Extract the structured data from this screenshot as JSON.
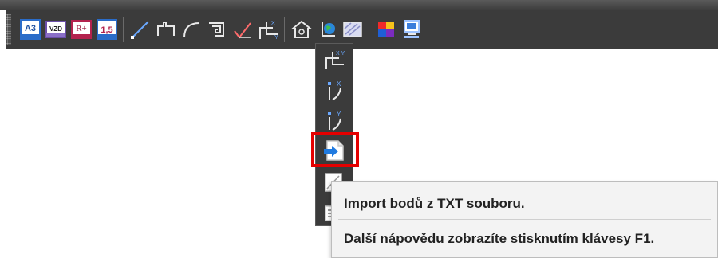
{
  "toolbar": {
    "icons": [
      {
        "name": "a3-paper-icon",
        "label": "A3"
      },
      {
        "name": "vzd-icon",
        "label": "VZD"
      },
      {
        "name": "r-plus-icon",
        "label": "R+"
      },
      {
        "name": "text-height-icon",
        "label": "1,5"
      },
      {
        "name": "line-icon"
      },
      {
        "name": "polyline-icon"
      },
      {
        "name": "arc-icon"
      },
      {
        "name": "offset-icon"
      },
      {
        "name": "check-angle-icon"
      },
      {
        "name": "coordinate-xy-icon",
        "label": "X Y"
      },
      {
        "name": "home-shape-icon"
      },
      {
        "name": "globe-import-icon"
      },
      {
        "name": "hatch-icon"
      },
      {
        "name": "color-palette-icon"
      },
      {
        "name": "computer-settings-icon"
      }
    ]
  },
  "flyout": {
    "items": [
      {
        "name": "coordinate-xy-icon",
        "label": "X Y"
      },
      {
        "name": "point-x-icon",
        "label": "X"
      },
      {
        "name": "point-y-icon",
        "label": "Y"
      },
      {
        "name": "import-points-txt-icon"
      },
      {
        "name": "export-icon"
      },
      {
        "name": "document-icon"
      }
    ]
  },
  "tooltip": {
    "title": "Import bodů z TXT souboru.",
    "help": "Další nápovědu zobrazíte stisknutím klávesy F1."
  },
  "colors": {
    "toolbar_bg": "#3b3b3b",
    "highlight": "#e50000",
    "tooltip_bg": "#f3f3f3"
  }
}
